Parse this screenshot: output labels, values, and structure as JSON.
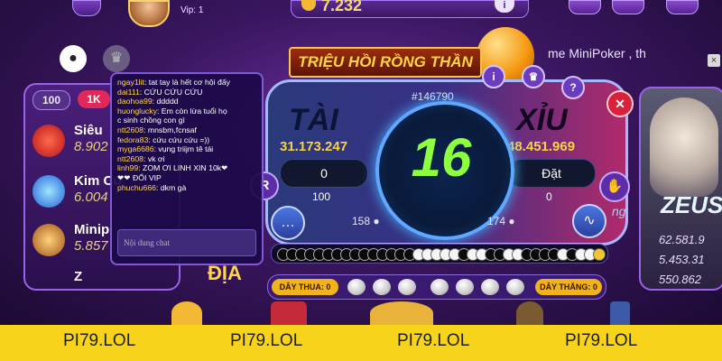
{
  "topbar": {
    "vip_label": "Vip: 1",
    "balance": "7.232",
    "info_label": "i"
  },
  "ticker": {
    "text": "me MiniPoker  ,   th",
    "close_label": "×"
  },
  "left_panel": {
    "tab_100": "100",
    "tab_1k": "1K",
    "games": [
      {
        "name": "Siêu",
        "value": "8.902"
      },
      {
        "name": "Kim Cư",
        "value": "6.004"
      },
      {
        "name": "Minip",
        "value": "5.857"
      },
      {
        "name": "Z",
        "value": ""
      }
    ]
  },
  "chat": {
    "messages": [
      {
        "user": "ngay1lit",
        "text": "tat tay là hết cơ hội đấy"
      },
      {
        "user": "dai111",
        "text": "CỨU CỨU CỨU"
      },
      {
        "user": "daohoa99",
        "text": "ddddd"
      },
      {
        "user": "huonglucky",
        "text": "Em còn lừa tuổi họ"
      },
      {
        "user": "",
        "text": "c sinh chồng con gì"
      },
      {
        "user": "ntt2608",
        "text": "mnsbm,fcnsaf"
      },
      {
        "user": "fedora83",
        "text": "cứu cứu cứu =))"
      },
      {
        "user": "myga6686",
        "text": "vụng triijm tê tái"
      },
      {
        "user": "ntt2608",
        "text": "vk ơi"
      },
      {
        "user": "linh99",
        "text": "ZOM ƠI LINH XIN 10k❤"
      },
      {
        "user": "",
        "text": "❤❤ ĐỔI VIP"
      },
      {
        "user": "phuchu666",
        "text": "dkm gà"
      }
    ],
    "input_placeholder": "Nội dung chat"
  },
  "game": {
    "banner": "TRIỆU HỒI RỒNG THẦN",
    "session_id": "#146790",
    "tai_label": "TÀI",
    "xiu_label": "XỈU",
    "tai_total": "31.173.247",
    "xiu_total": "48.451.969",
    "tai_bet": "0",
    "xiu_bet": "Đặt",
    "tai_sub": "100",
    "xiu_sub": "0",
    "dice_total": "16",
    "tai_players": "158",
    "xiu_players": "174",
    "r_label": "R",
    "help_label": "?",
    "close_label": "✕",
    "history": [
      "b",
      "b",
      "b",
      "b",
      "b",
      "b",
      "b",
      "b",
      "b",
      "b",
      "b",
      "b",
      "b",
      "b",
      "b",
      "w",
      "w",
      "w",
      "w",
      "w",
      "b",
      "w",
      "w",
      "b",
      "b",
      "w",
      "w",
      "b",
      "b",
      "b",
      "b",
      "w",
      "b",
      "w",
      "w",
      "y"
    ],
    "streak_lose_label": "DÂY THUA: 0",
    "streak_win_label": "DÂY THẮNG: 0"
  },
  "side_game": {
    "title": "ZEUS",
    "values": [
      "62.581.9",
      "5.453.31",
      "550.862"
    ]
  },
  "background_words": {
    "dia": "ĐỊA",
    "partial": "ng"
  },
  "footer": {
    "watermarks": [
      "PI79.LOL",
      "PI79.LOL",
      "PI79.LOL",
      "PI79.LOL"
    ]
  },
  "colors": {
    "accent": "#f6d34a",
    "dice_number": "#8dff3e",
    "footer_bg": "#f7d31b",
    "tai_panel": "#2a3a7a",
    "xiu_panel": "#b02a6b"
  }
}
